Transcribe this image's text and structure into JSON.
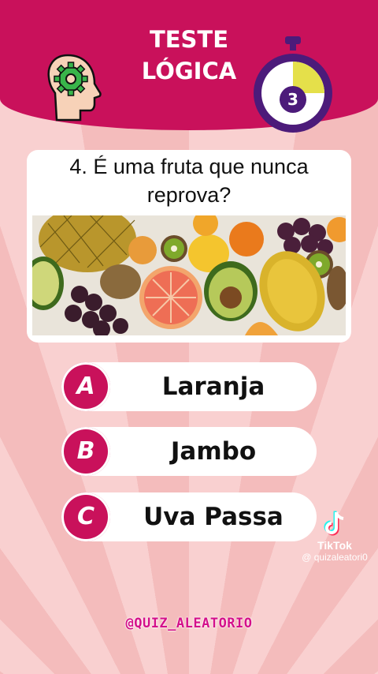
{
  "header": {
    "title_line1": "TESTE",
    "title_line2": "LÓGICA",
    "timer_value": "3",
    "timer_progress": 0.25,
    "colors": {
      "header": "#c9115b",
      "timer_ring": "#4c1b7a",
      "timer_fill": "#e5e04a"
    }
  },
  "question": {
    "text": "4. É uma fruta que nunca reprova?",
    "image": "fruits-photo"
  },
  "options": [
    {
      "letter": "A",
      "label": "Laranja"
    },
    {
      "letter": "B",
      "label": "Jambo"
    },
    {
      "letter": "C",
      "label": "Uva Passa"
    }
  ],
  "watermark": {
    "app": "TikTok",
    "handle": "@ quizaleatori0"
  },
  "footer": {
    "handle": "@QUIZ_ALEATORIO"
  },
  "icons": [
    "head-gear-icon",
    "stopwatch-icon",
    "tiktok-logo-icon"
  ]
}
